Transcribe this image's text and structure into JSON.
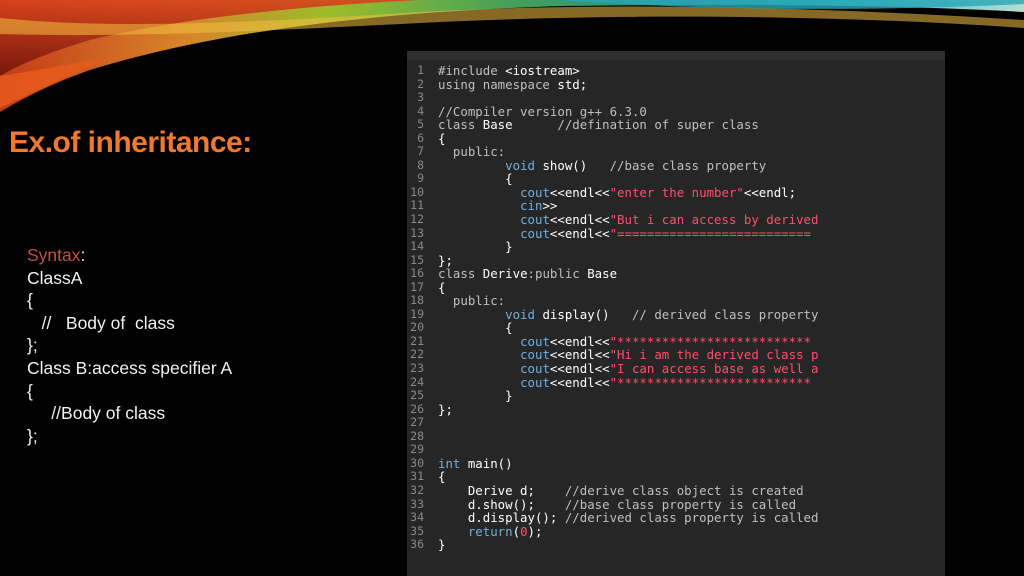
{
  "slide": {
    "title": "Ex.of inheritance:",
    "syntax_lines": [
      [
        {
          "text": "Syntax",
          "style": "kw"
        },
        {
          "text": ":"
        }
      ],
      [
        {
          "text": "ClassA"
        }
      ],
      [
        {
          "text": "{"
        }
      ],
      [
        {
          "text": "   //   Body of  class"
        }
      ],
      [
        {
          "text": "};"
        }
      ],
      [
        {
          "text": "Class B:access specifier A"
        }
      ],
      [
        {
          "text": "{"
        }
      ],
      [
        {
          "text": "     //Body of class"
        }
      ],
      [
        {
          "text": "};"
        }
      ]
    ]
  },
  "code": {
    "lines": [
      {
        "n": "1",
        "tokens": [
          {
            "t": "#include ",
            "c": "comment"
          },
          {
            "t": "<iostream>",
            "c": "plain"
          }
        ]
      },
      {
        "n": "2",
        "tokens": [
          {
            "t": "using namespace ",
            "c": "comment"
          },
          {
            "t": "std;",
            "c": "plain"
          }
        ]
      },
      {
        "n": "3",
        "tokens": []
      },
      {
        "n": "4",
        "tokens": [
          {
            "t": "//Compiler version g++ 6.3.0",
            "c": "comment"
          }
        ]
      },
      {
        "n": "5",
        "tokens": [
          {
            "t": "class ",
            "c": "comment"
          },
          {
            "t": "Base",
            "c": "plain"
          },
          {
            "t": "      //defination of super class",
            "c": "comment"
          }
        ]
      },
      {
        "n": "6",
        "tokens": [
          {
            "t": "{",
            "c": "plain"
          }
        ]
      },
      {
        "n": "7",
        "tokens": [
          {
            "t": "  public:",
            "c": "comment"
          }
        ]
      },
      {
        "n": "8",
        "tokens": [
          {
            "t": "         ",
            "c": "plain"
          },
          {
            "t": "void ",
            "c": "keyword"
          },
          {
            "t": "show()",
            "c": "plain"
          },
          {
            "t": "   //base class property",
            "c": "comment"
          }
        ]
      },
      {
        "n": "9",
        "tokens": [
          {
            "t": "         {",
            "c": "plain"
          }
        ]
      },
      {
        "n": "10",
        "tokens": [
          {
            "t": "           ",
            "c": "plain"
          },
          {
            "t": "cout",
            "c": "cout"
          },
          {
            "t": "<<endl<<",
            "c": "plain"
          },
          {
            "t": "\"enter the number\"",
            "c": "string"
          },
          {
            "t": "<<endl;",
            "c": "plain"
          }
        ]
      },
      {
        "n": "11",
        "tokens": [
          {
            "t": "           ",
            "c": "plain"
          },
          {
            "t": "cin",
            "c": "cout"
          },
          {
            "t": ">>",
            "c": "plain"
          }
        ]
      },
      {
        "n": "12",
        "tokens": [
          {
            "t": "           ",
            "c": "plain"
          },
          {
            "t": "cout",
            "c": "cout"
          },
          {
            "t": "<<endl<<",
            "c": "plain"
          },
          {
            "t": "\"But i can access by derived",
            "c": "string"
          }
        ]
      },
      {
        "n": "13",
        "tokens": [
          {
            "t": "           ",
            "c": "plain"
          },
          {
            "t": "cout",
            "c": "cout"
          },
          {
            "t": "<<endl<<",
            "c": "plain"
          },
          {
            "t": "\"==========================",
            "c": "string"
          }
        ]
      },
      {
        "n": "14",
        "tokens": [
          {
            "t": "         }",
            "c": "plain"
          }
        ]
      },
      {
        "n": "15",
        "tokens": [
          {
            "t": "};",
            "c": "plain"
          }
        ]
      },
      {
        "n": "16",
        "tokens": [
          {
            "t": "class ",
            "c": "comment"
          },
          {
            "t": "Derive",
            "c": "plain"
          },
          {
            "t": ":public ",
            "c": "comment"
          },
          {
            "t": "Base",
            "c": "plain"
          }
        ]
      },
      {
        "n": "17",
        "tokens": [
          {
            "t": "{",
            "c": "plain"
          }
        ]
      },
      {
        "n": "18",
        "tokens": [
          {
            "t": "  public:",
            "c": "comment"
          }
        ]
      },
      {
        "n": "19",
        "tokens": [
          {
            "t": "         ",
            "c": "plain"
          },
          {
            "t": "void ",
            "c": "keyword"
          },
          {
            "t": "display()",
            "c": "plain"
          },
          {
            "t": "   // derived class property",
            "c": "comment"
          }
        ]
      },
      {
        "n": "20",
        "tokens": [
          {
            "t": "         {",
            "c": "plain"
          }
        ]
      },
      {
        "n": "21",
        "tokens": [
          {
            "t": "           ",
            "c": "plain"
          },
          {
            "t": "cout",
            "c": "cout"
          },
          {
            "t": "<<endl<<",
            "c": "plain"
          },
          {
            "t": "\"**************************",
            "c": "string"
          }
        ]
      },
      {
        "n": "22",
        "tokens": [
          {
            "t": "           ",
            "c": "plain"
          },
          {
            "t": "cout",
            "c": "cout"
          },
          {
            "t": "<<endl<<",
            "c": "plain"
          },
          {
            "t": "\"Hi i am the derived class p",
            "c": "string"
          }
        ]
      },
      {
        "n": "23",
        "tokens": [
          {
            "t": "           ",
            "c": "plain"
          },
          {
            "t": "cout",
            "c": "cout"
          },
          {
            "t": "<<endl<<",
            "c": "plain"
          },
          {
            "t": "\"I can access base as well a",
            "c": "string"
          }
        ]
      },
      {
        "n": "24",
        "tokens": [
          {
            "t": "           ",
            "c": "plain"
          },
          {
            "t": "cout",
            "c": "cout"
          },
          {
            "t": "<<endl<<",
            "c": "plain"
          },
          {
            "t": "\"**************************",
            "c": "string"
          }
        ]
      },
      {
        "n": "25",
        "tokens": [
          {
            "t": "         }",
            "c": "plain"
          }
        ]
      },
      {
        "n": "26",
        "tokens": [
          {
            "t": "};",
            "c": "plain"
          }
        ]
      },
      {
        "n": "27",
        "tokens": []
      },
      {
        "n": "28",
        "tokens": []
      },
      {
        "n": "29",
        "tokens": []
      },
      {
        "n": "30",
        "tokens": [
          {
            "t": "int ",
            "c": "keyword"
          },
          {
            "t": "main()",
            "c": "plain"
          }
        ]
      },
      {
        "n": "31",
        "tokens": [
          {
            "t": "{",
            "c": "plain"
          }
        ]
      },
      {
        "n": "32",
        "tokens": [
          {
            "t": "    Derive d;    ",
            "c": "plain"
          },
          {
            "t": "//derive class object is created",
            "c": "comment"
          }
        ]
      },
      {
        "n": "33",
        "tokens": [
          {
            "t": "    d.show();    ",
            "c": "plain"
          },
          {
            "t": "//base class property is called",
            "c": "comment"
          }
        ]
      },
      {
        "n": "34",
        "tokens": [
          {
            "t": "    d.display(); ",
            "c": "plain"
          },
          {
            "t": "//derived class property is called",
            "c": "comment"
          }
        ]
      },
      {
        "n": "35",
        "tokens": [
          {
            "t": "    ",
            "c": "plain"
          },
          {
            "t": "return",
            "c": "keyword"
          },
          {
            "t": "(",
            "c": "plain"
          },
          {
            "t": "0",
            "c": "string"
          },
          {
            "t": ");",
            "c": "plain"
          }
        ]
      },
      {
        "n": "36",
        "tokens": [
          {
            "t": "}",
            "c": "plain"
          }
        ]
      }
    ]
  },
  "colors": {
    "background": "#000000",
    "title": "#ef7a2f",
    "syntax_keyword": "#c0504d",
    "code_background": "#262626"
  }
}
